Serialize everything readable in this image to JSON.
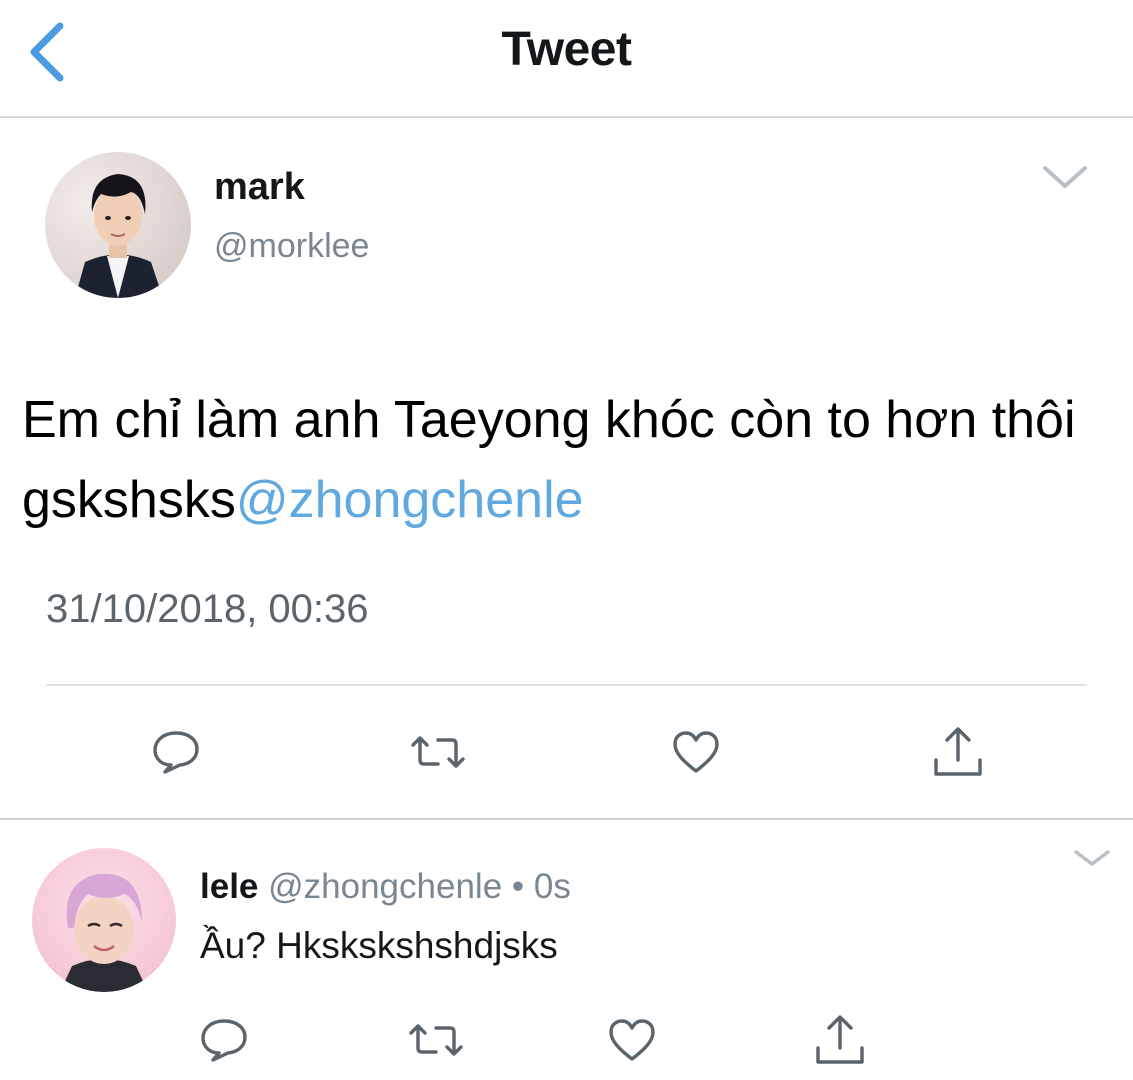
{
  "header": {
    "title": "Tweet",
    "back_icon": "chevron-left-icon",
    "accent_color": "#4a9be0"
  },
  "tweet": {
    "author_name": "mark",
    "author_handle": "@morklee",
    "text_before_mention": "Em chỉ làm anh Taeyong khóc còn to hơn thôi gskshsks",
    "mention": "@zhongchenle",
    "timestamp": "31/10/2018, 00:36",
    "mention_color": "#5fa9e0",
    "actions": [
      "reply-icon",
      "retweet-icon",
      "like-icon",
      "share-icon"
    ]
  },
  "reply": {
    "author_name": "lele",
    "author_handle": "@zhongchenle",
    "separator": "•",
    "time_ago": "0s",
    "text": "Ầu? Hkskskshshdjsks",
    "actions": [
      "reply-icon",
      "retweet-icon",
      "like-icon",
      "share-icon"
    ]
  }
}
